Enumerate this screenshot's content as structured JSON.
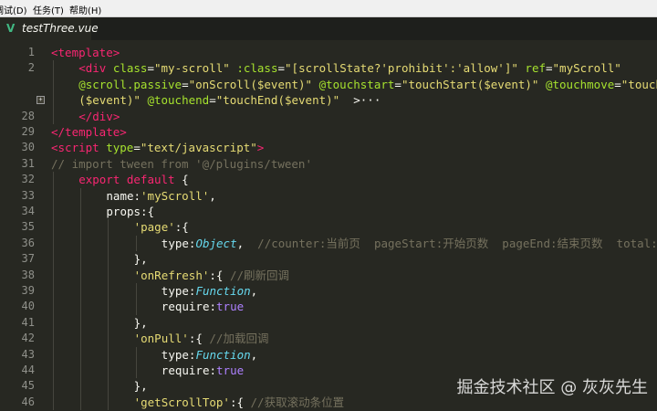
{
  "menu": {
    "items": [
      "调试(D)",
      "任务(T)",
      "帮助(H)"
    ]
  },
  "tab": {
    "filename": "testThree.vue",
    "icon": "vue-logo-icon",
    "icon_glyph": "V"
  },
  "watermark": "掘金技术社区 @ 灰灰先生",
  "colors": {
    "background": "#272822",
    "tag": "#f92672",
    "attr": "#a6e22e",
    "string": "#e6db74",
    "comment": "#75715e",
    "keyword": "#66d9ef"
  },
  "lines": [
    {
      "n": "1",
      "indent": 0,
      "tokens": [
        [
          "t",
          "<template>"
        ]
      ]
    },
    {
      "n": "2",
      "indent": 1,
      "tokens": [
        [
          "t",
          "<div "
        ],
        [
          "a",
          "class"
        ],
        [
          "o",
          "="
        ],
        [
          "s",
          "\"my-scroll\""
        ],
        [
          "o",
          " "
        ],
        [
          "a",
          ":class"
        ],
        [
          "o",
          "="
        ],
        [
          "s",
          "\"[scrollState?'prohibit':'allow']\""
        ],
        [
          "o",
          " "
        ],
        [
          "a",
          "ref"
        ],
        [
          "o",
          "="
        ],
        [
          "s",
          "\"myScroll\""
        ]
      ]
    },
    {
      "n": "",
      "indent": 1,
      "tokens": [
        [
          "a",
          "@scroll.passive"
        ],
        [
          "o",
          "="
        ],
        [
          "s",
          "\"onScroll($event)\""
        ],
        [
          "o",
          " "
        ],
        [
          "a",
          "@touchstart"
        ],
        [
          "o",
          "="
        ],
        [
          "s",
          "\"touchStart($event)\""
        ],
        [
          "o",
          " "
        ],
        [
          "a",
          "@touchmove"
        ],
        [
          "o",
          "="
        ],
        [
          "s",
          "\"touchMove"
        ]
      ]
    },
    {
      "n": "",
      "indent": 1,
      "fold": true,
      "tokens": [
        [
          "s",
          "($event)\""
        ],
        [
          "o",
          " "
        ],
        [
          "a",
          "@touchend"
        ],
        [
          "o",
          "="
        ],
        [
          "s",
          "\"touchEnd($event)\""
        ],
        [
          "o",
          "  >···"
        ]
      ]
    },
    {
      "n": "28",
      "indent": 1,
      "tokens": [
        [
          "t",
          "</div>"
        ]
      ]
    },
    {
      "n": "29",
      "indent": 0,
      "tokens": [
        [
          "t",
          "</template>"
        ]
      ]
    },
    {
      "n": "30",
      "indent": 0,
      "tokens": [
        [
          "t",
          "<script "
        ],
        [
          "a",
          "type"
        ],
        [
          "o",
          "="
        ],
        [
          "s",
          "\"text/javascript\""
        ],
        [
          "t",
          ">"
        ]
      ]
    },
    {
      "n": "31",
      "indent": 0,
      "tokens": [
        [
          "c",
          "// import tween from '@/plugins/tween'"
        ]
      ]
    },
    {
      "n": "32",
      "indent": 1,
      "tokens": [
        [
          "r",
          "export"
        ],
        [
          "o",
          " "
        ],
        [
          "r",
          "default"
        ],
        [
          "o",
          " {"
        ]
      ]
    },
    {
      "n": "33",
      "indent": 2,
      "tokens": [
        [
          "o",
          "name:"
        ],
        [
          "s",
          "'myScroll'"
        ],
        [
          "o",
          ","
        ]
      ]
    },
    {
      "n": "34",
      "indent": 2,
      "tokens": [
        [
          "o",
          "props:{"
        ]
      ]
    },
    {
      "n": "35",
      "indent": 3,
      "tokens": [
        [
          "s",
          "'page'"
        ],
        [
          "o",
          ":{"
        ]
      ]
    },
    {
      "n": "36",
      "indent": 4,
      "tokens": [
        [
          "o",
          "type:"
        ],
        [
          "k",
          "Object"
        ],
        [
          "o",
          ",  "
        ],
        [
          "c",
          "//counter:当前页  pageStart:开始页数  pageEnd:结束页数  total:总页"
        ]
      ]
    },
    {
      "n": "37",
      "indent": 3,
      "tokens": [
        [
          "o",
          "},"
        ]
      ]
    },
    {
      "n": "38",
      "indent": 3,
      "tokens": [
        [
          "s",
          "'onRefresh'"
        ],
        [
          "o",
          ":{ "
        ],
        [
          "c",
          "//刷新回调"
        ]
      ]
    },
    {
      "n": "39",
      "indent": 4,
      "tokens": [
        [
          "o",
          "type:"
        ],
        [
          "k",
          "Function"
        ],
        [
          "o",
          ","
        ]
      ]
    },
    {
      "n": "40",
      "indent": 4,
      "tokens": [
        [
          "o",
          "require:"
        ],
        [
          "n",
          "true"
        ]
      ]
    },
    {
      "n": "41",
      "indent": 3,
      "tokens": [
        [
          "o",
          "},"
        ]
      ]
    },
    {
      "n": "42",
      "indent": 3,
      "tokens": [
        [
          "s",
          "'onPull'"
        ],
        [
          "o",
          ":{ "
        ],
        [
          "c",
          "//加载回调"
        ]
      ]
    },
    {
      "n": "43",
      "indent": 4,
      "tokens": [
        [
          "o",
          "type:"
        ],
        [
          "k",
          "Function"
        ],
        [
          "o",
          ","
        ]
      ]
    },
    {
      "n": "44",
      "indent": 4,
      "tokens": [
        [
          "o",
          "require:"
        ],
        [
          "n",
          "true"
        ]
      ]
    },
    {
      "n": "45",
      "indent": 3,
      "tokens": [
        [
          "o",
          "},"
        ]
      ]
    },
    {
      "n": "46",
      "indent": 3,
      "tokens": [
        [
          "s",
          "'getScrollTop'"
        ],
        [
          "o",
          ":{ "
        ],
        [
          "c",
          "//获取滚动条位置"
        ]
      ]
    }
  ]
}
